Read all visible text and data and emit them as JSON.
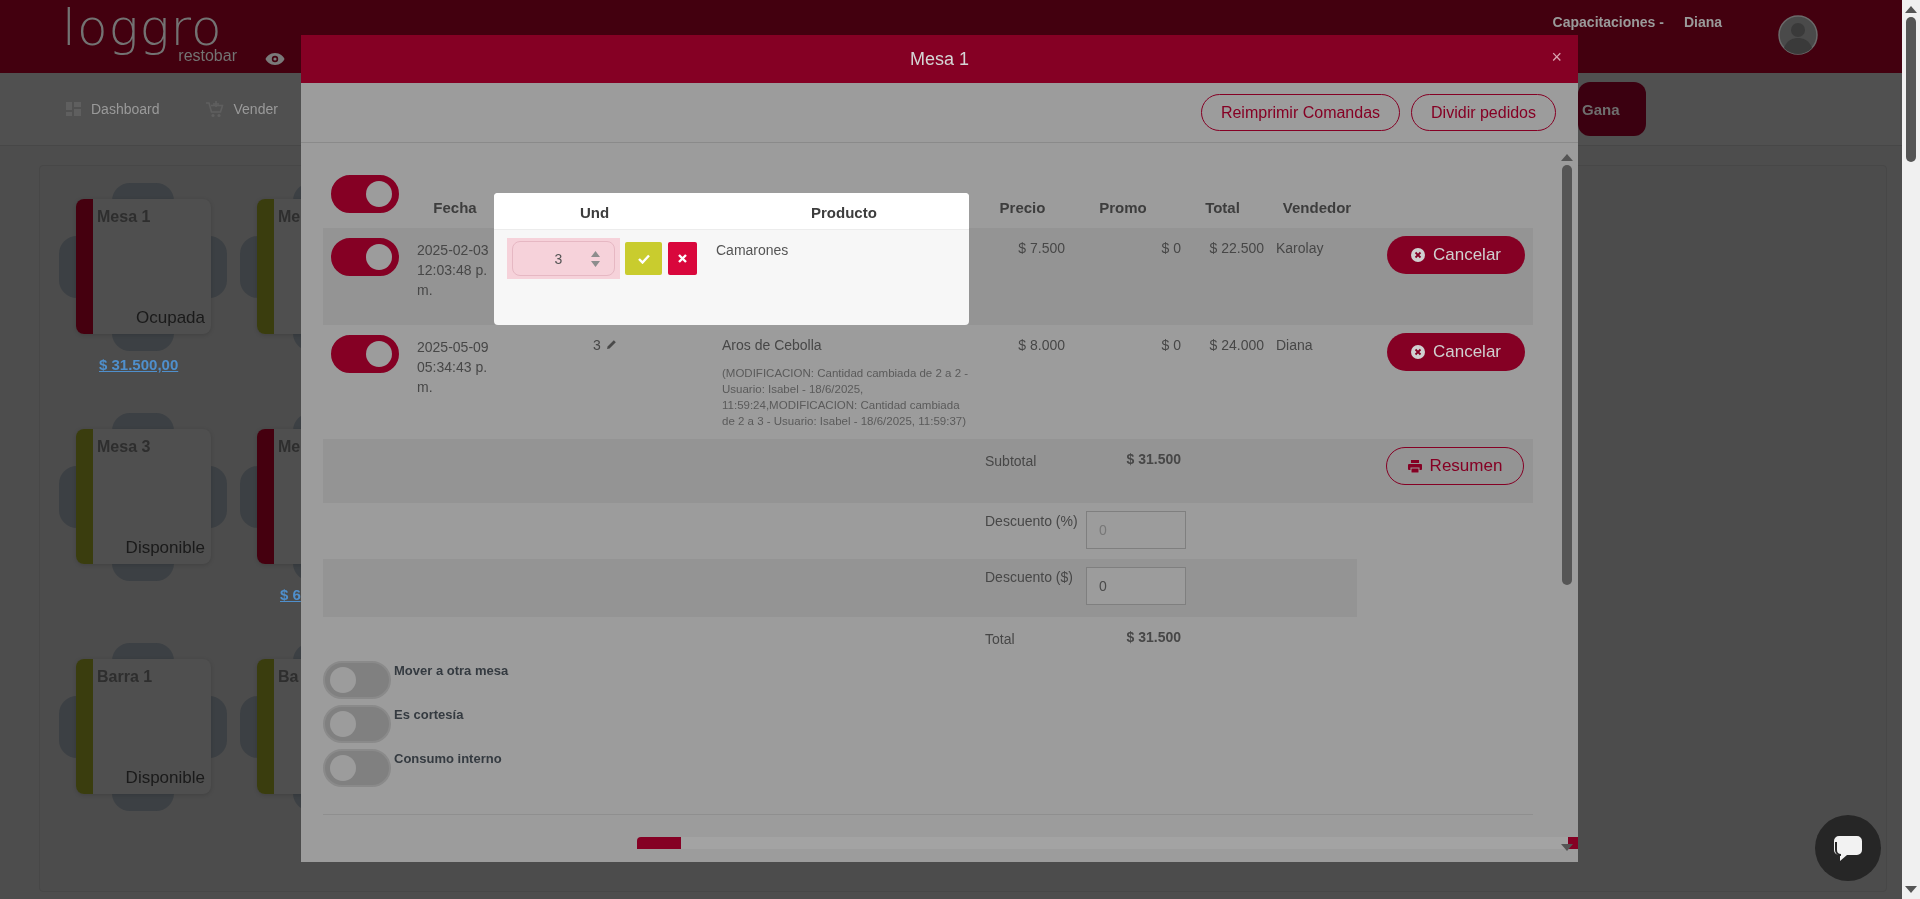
{
  "header": {
    "logo": "loggro",
    "logo_sub": "restobar",
    "company": "Capacitaciones -",
    "user": "Diana"
  },
  "nav": [
    {
      "label": "Dashboard"
    },
    {
      "label": "Vender"
    }
  ],
  "nav_button": "Gana",
  "tables": [
    {
      "name": "Mesa 1",
      "status": "Ocupada",
      "color": "#45000f",
      "amount": "$ 31.500,00"
    },
    {
      "name": "Me",
      "color": "#3a3d0e"
    },
    {
      "name": "Mesa 3",
      "status": "Disponible",
      "color": "#3a3d0e"
    },
    {
      "name": "Me",
      "color": "#45000f",
      "amount": "$ 6"
    },
    {
      "name": "Barra 1",
      "status": "Disponible",
      "color": "#3a3d0e"
    },
    {
      "name": "Ba",
      "color": "#3a3d0e"
    }
  ],
  "modal": {
    "title": "Mesa 1",
    "close": "×",
    "actions": [
      "Reimprimir Comandas",
      "Dividir pedidos"
    ],
    "select_all_on": true,
    "columns": [
      "Fecha",
      "Und",
      "Producto",
      "Precio",
      "Promo",
      "Total",
      "Vendedor"
    ],
    "rows": [
      {
        "on": true,
        "editing": true,
        "date": "2025-02-03 12:03:48 p. m.",
        "qty": "3",
        "product": "Camarones",
        "price": "$ 7.500",
        "promo": "$ 0",
        "total": "$ 22.500",
        "seller": "Karolay",
        "action": "Cancelar"
      },
      {
        "on": true,
        "editing": false,
        "date": "2025-05-09 05:34:43 p. m.",
        "qty": "3",
        "product": "Aros de Cebolla",
        "note": "(MODIFICACION: Cantidad cambiada de 2 a 2 - Usuario: Isabel - 18/6/2025, 11:59:24,MODIFICACION: Cantidad cambiada de 2 a 3 - Usuario: Isabel - 18/6/2025, 11:59:37)",
        "price": "$ 8.000",
        "promo": "$ 0",
        "total": "$ 24.000",
        "seller": "Diana",
        "action": "Cancelar"
      }
    ],
    "summary": [
      {
        "kind": "amount",
        "label": "Subtotal",
        "value": "$ 31.500",
        "button": "Resumen"
      },
      {
        "kind": "input",
        "label": "Descuento (%)",
        "placeholder": "0"
      },
      {
        "kind": "input",
        "label": "Descuento ($)",
        "value": "0"
      },
      {
        "kind": "amount",
        "label": "Total",
        "value": "$ 31.500"
      }
    ],
    "options": [
      {
        "label": "Mover a otra mesa",
        "on": false
      },
      {
        "label": "Es cortesía",
        "on": false
      },
      {
        "label": "Consumo interno",
        "on": false
      }
    ]
  }
}
